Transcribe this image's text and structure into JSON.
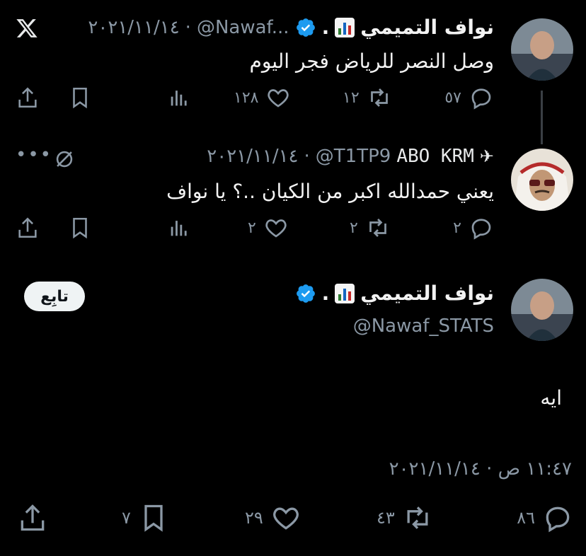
{
  "tweets": [
    {
      "name": "نواف التميمي",
      "emoji_suffix": ".",
      "handle": "@Nawaf...",
      "date": "٢٠٢١/١١/١٤",
      "text": "وصل النصر للرياض فجر اليوم",
      "replies": "٥٧",
      "retweets": "١٢",
      "likes": "١٢٨"
    },
    {
      "name": "ABO KRM",
      "handle": "@T1TP9",
      "date": "٢٠٢١/١١/١٤",
      "text": "يعني حمدالله اكبر من الكيان ..؟ يا نواف",
      "replies": "٢",
      "retweets": "٢",
      "likes": "٢"
    }
  ],
  "main": {
    "name": "نواف التميمي",
    "emoji_suffix": ".",
    "handle": "@Nawaf_STATS",
    "follow_label": "تابِع",
    "text": "ايه",
    "timestamp": "١١:٤٧ ص · ٢٠٢١/١١/١٤",
    "replies": "٨٦",
    "retweets": "٤٣",
    "likes": "٢٩",
    "bookmarks": "٧"
  },
  "icons": {
    "logo": "x-logo-icon",
    "verified_color": "#1d9bf0"
  }
}
